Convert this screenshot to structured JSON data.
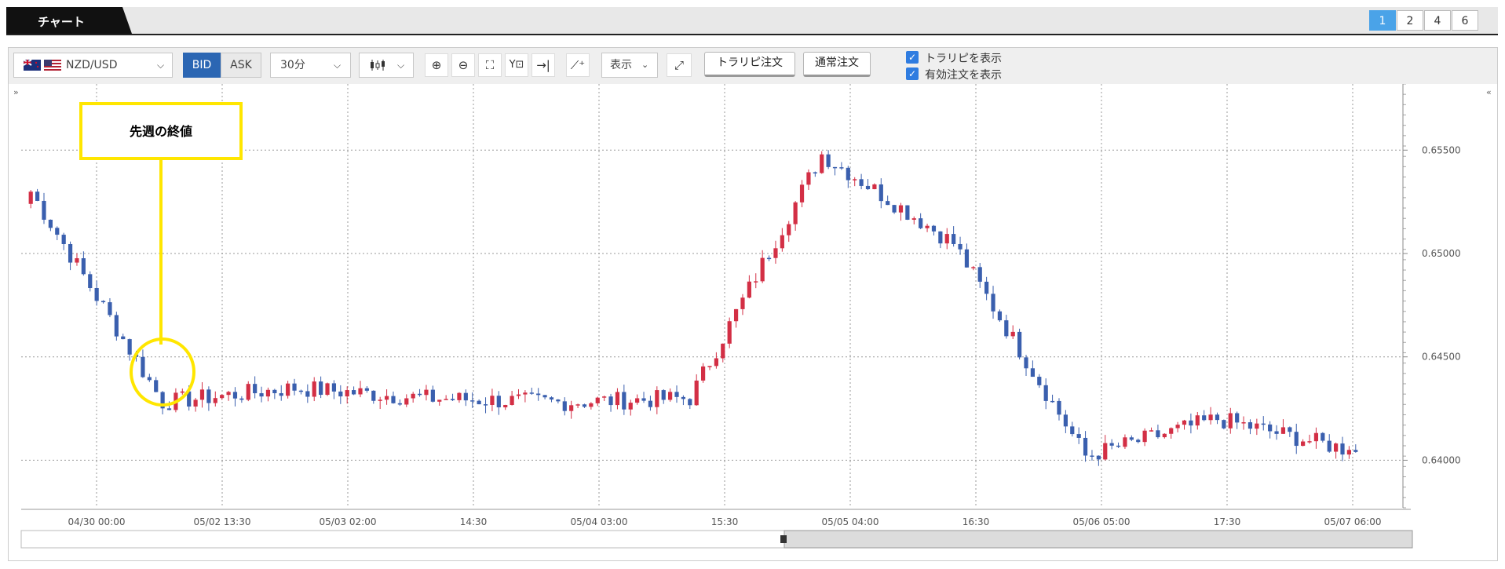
{
  "tab": {
    "label": "チャート",
    "pages": [
      "1",
      "2",
      "4",
      "6"
    ],
    "active_page": "1"
  },
  "toolbar": {
    "pair": "NZD/USD",
    "bid_label": "BID",
    "ask_label": "ASK",
    "interval": "30分",
    "display_label": "表示",
    "traripi_order_label": "トラリピ注文",
    "normal_order_label": "通常注文",
    "show_traripi_label": "トラリピを表示",
    "show_active_orders_label": "有効注文を表示",
    "show_traripi_checked": true,
    "show_active_orders_checked": true
  },
  "annotation": {
    "label": "先週の終値"
  },
  "colors": {
    "up": "#d32f45",
    "down": "#3a5fae",
    "accent": "#2b7bd6",
    "highlight": "#ffe600"
  },
  "chart_data": {
    "type": "candlestick",
    "instrument": "NZD/USD",
    "timeframe": "30分",
    "y_ticks": [
      "0.65500",
      "0.65000",
      "0.64500",
      "0.64000"
    ],
    "x_ticks": [
      "04/30 00:00",
      "05/02 13:30",
      "05/03 02:00",
      "14:30",
      "05/04 03:00",
      "15:30",
      "05/05 04:00",
      "16:30",
      "05/06 05:00",
      "17:30",
      "05/07 06:00"
    ],
    "ylim": [
      0.6377,
      0.6582
    ],
    "series": [
      {
        "name": "close",
        "key_points": [
          {
            "t": "04/30 00:00",
            "price": 0.653
          },
          {
            "t": "05/02 13:30",
            "price": 0.6428
          },
          {
            "t": "05/03 02:00",
            "price": 0.6435
          },
          {
            "t": "14:30",
            "price": 0.643
          },
          {
            "t": "05/04 03:00",
            "price": 0.6428
          },
          {
            "t": "15:30",
            "price": 0.643
          },
          {
            "t": "05/05 04:00",
            "price": 0.6548
          },
          {
            "t": "16:30",
            "price": 0.6505
          },
          {
            "t": "05/06 05:00",
            "price": 0.6402
          },
          {
            "t": "17:30",
            "price": 0.642
          },
          {
            "t": "05/07 06:00",
            "price": 0.6405
          }
        ]
      }
    ],
    "grid": true
  }
}
